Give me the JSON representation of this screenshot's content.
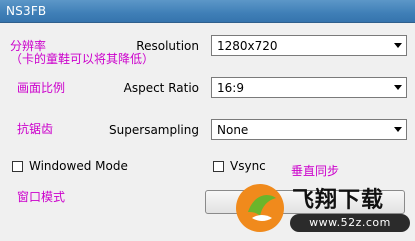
{
  "window": {
    "title": "NS3FB"
  },
  "annotations": {
    "resolution_note_line1": "分辨率",
    "resolution_note_line2": "（卡的童鞋可以将其降低）",
    "aspect_note": "画面比例",
    "supersampling_note": "抗锯齿",
    "vsync_note": "垂直同步",
    "windowed_note": "窗口模式"
  },
  "settings": {
    "resolution": {
      "label": "Resolution",
      "value": "1280x720"
    },
    "aspect_ratio": {
      "label": "Aspect Ratio",
      "value": "16:9"
    },
    "supersampling": {
      "label": "Supersampling",
      "value": "None"
    }
  },
  "checkboxes": {
    "windowed_mode": {
      "label": "Windowed Mode",
      "checked": false
    },
    "vsync": {
      "label": "Vsync",
      "checked": false
    }
  },
  "watermark": {
    "title": "飞翔下载",
    "url": "www.52z.com"
  },
  "colors": {
    "annotation": "#cc00cc",
    "titlebar": "#3f7fb7",
    "logo_orange": "#f08a1c",
    "logo_green": "#6bb52b"
  }
}
